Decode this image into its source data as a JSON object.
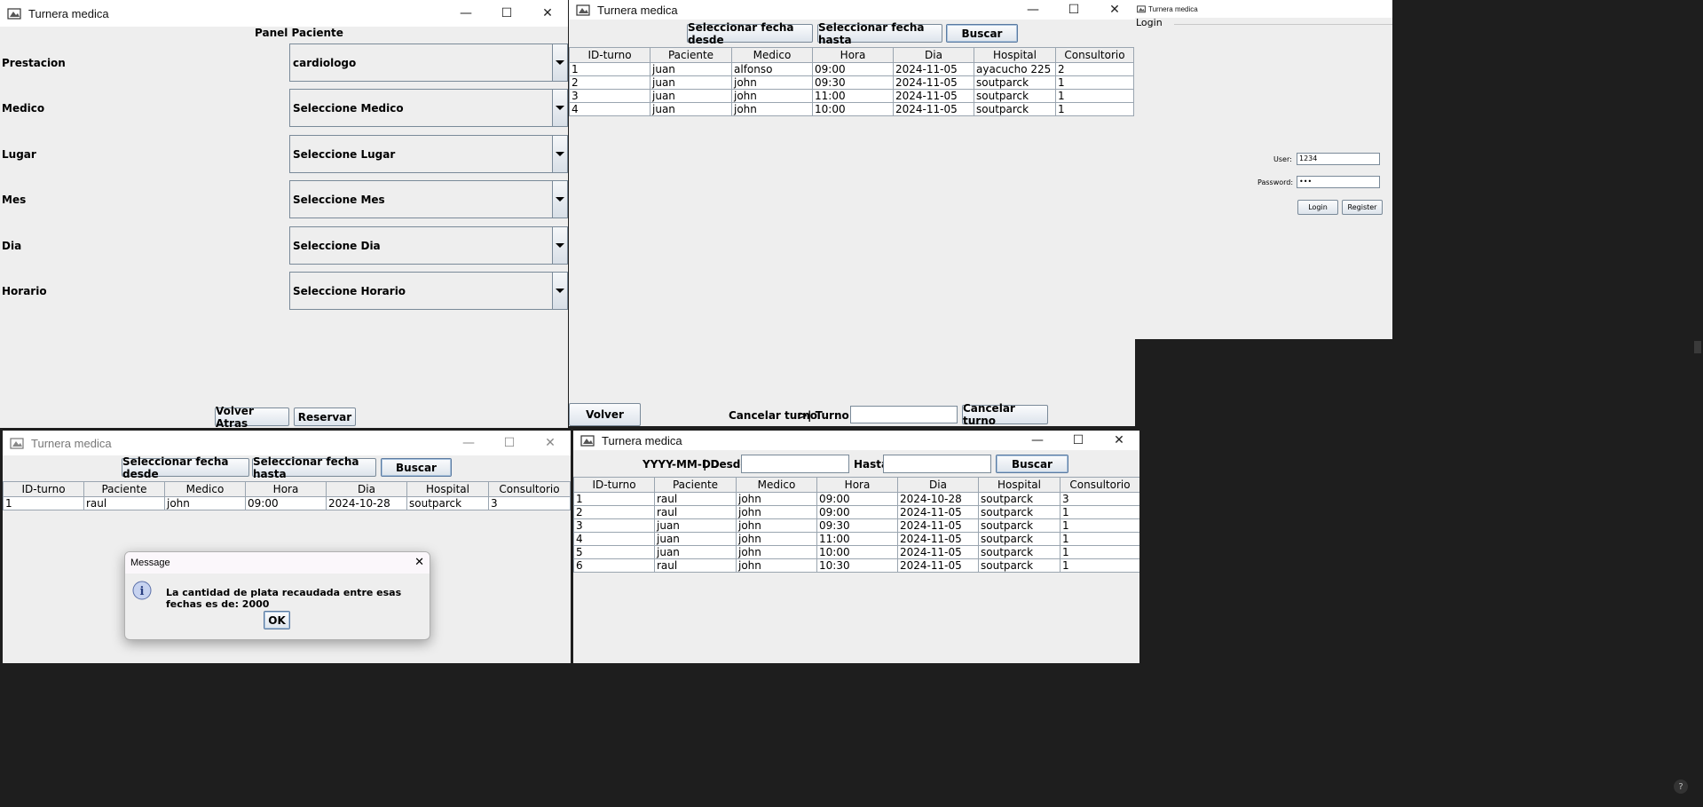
{
  "window_title": "Turnera medica",
  "panel_paciente": {
    "heading": "Panel Paciente",
    "fields": [
      {
        "label": "Prestacion",
        "value": "cardiologo"
      },
      {
        "label": "Medico",
        "value": "Seleccione Medico"
      },
      {
        "label": "Lugar",
        "value": "Seleccione Lugar"
      },
      {
        "label": "Mes",
        "value": "Seleccione Mes"
      },
      {
        "label": "Dia",
        "value": "Seleccione Dia"
      },
      {
        "label": "Horario",
        "value": "Seleccione Horario"
      }
    ],
    "back_button": "Volver Atras",
    "reserve_button": "Reservar"
  },
  "turnos_window": {
    "btn_desde": "Seleccionar fecha desde",
    "btn_hasta": "Seleccionar fecha hasta",
    "btn_buscar": "Buscar",
    "columns": [
      "ID-turno",
      "Paciente",
      "Medico",
      "Hora",
      "Dia",
      "Hospital",
      "Consultorio"
    ],
    "rows": [
      [
        "1",
        "juan",
        "alfonso",
        "09:00",
        "2024-11-05",
        "ayacucho 225",
        "2"
      ],
      [
        "2",
        "juan",
        "john",
        "09:30",
        "2024-11-05",
        "soutparck",
        "1"
      ],
      [
        "3",
        "juan",
        "john",
        "11:00",
        "2024-11-05",
        "soutparck",
        "1"
      ],
      [
        "4",
        "juan",
        "john",
        "10:00",
        "2024-11-05",
        "soutparck",
        "1"
      ]
    ],
    "btn_volver": "Volver",
    "cancel_label": "Cancelar turno",
    "turno_id_label": ">| Turno ID:",
    "turno_id_value": "",
    "btn_cancelar": "Cancelar turno"
  },
  "login_window": {
    "title": "Turnera medica",
    "heading": "Login",
    "user_label": "User:",
    "user_value": "1234",
    "password_label": "Password:",
    "password_value": "•••",
    "btn_login": "Login",
    "btn_register": "Register"
  },
  "recaudacion_window": {
    "btn_desde": "Seleccionar fecha desde",
    "btn_hasta": "Seleccionar fecha hasta",
    "btn_buscar": "Buscar",
    "columns": [
      "ID-turno",
      "Paciente",
      "Medico",
      "Hora",
      "Dia",
      "Hospital",
      "Consultorio"
    ],
    "rows": [
      [
        "1",
        "raul",
        "john",
        "09:00",
        "2024-10-28",
        "soutparck",
        "3"
      ]
    ]
  },
  "message_dialog": {
    "title": "Message",
    "text": "La cantidad de plata recaudada entre esas fechas es de: 2000",
    "ok": "OK"
  },
  "rango_window": {
    "format_label": "YYYY-MM-DD",
    "desde_label": "| Desde:",
    "desde_value": "",
    "hasta_label": "Hasta:",
    "hasta_value": "",
    "btn_buscar": "Buscar",
    "columns": [
      "ID-turno",
      "Paciente",
      "Medico",
      "Hora",
      "Dia",
      "Hospital",
      "Consultorio"
    ],
    "rows": [
      [
        "1",
        "raul",
        "john",
        "09:00",
        "2024-10-28",
        "soutparck",
        "3"
      ],
      [
        "2",
        "raul",
        "john",
        "09:00",
        "2024-11-05",
        "soutparck",
        "1"
      ],
      [
        "3",
        "juan",
        "john",
        "09:30",
        "2024-11-05",
        "soutparck",
        "1"
      ],
      [
        "4",
        "juan",
        "john",
        "11:00",
        "2024-11-05",
        "soutparck",
        "1"
      ],
      [
        "5",
        "juan",
        "john",
        "10:00",
        "2024-11-05",
        "soutparck",
        "1"
      ],
      [
        "6",
        "raul",
        "john",
        "10:30",
        "2024-11-05",
        "soutparck",
        "1"
      ]
    ]
  },
  "window_controls": {
    "minimize": "—",
    "maximize": "☐",
    "close": "✕"
  }
}
